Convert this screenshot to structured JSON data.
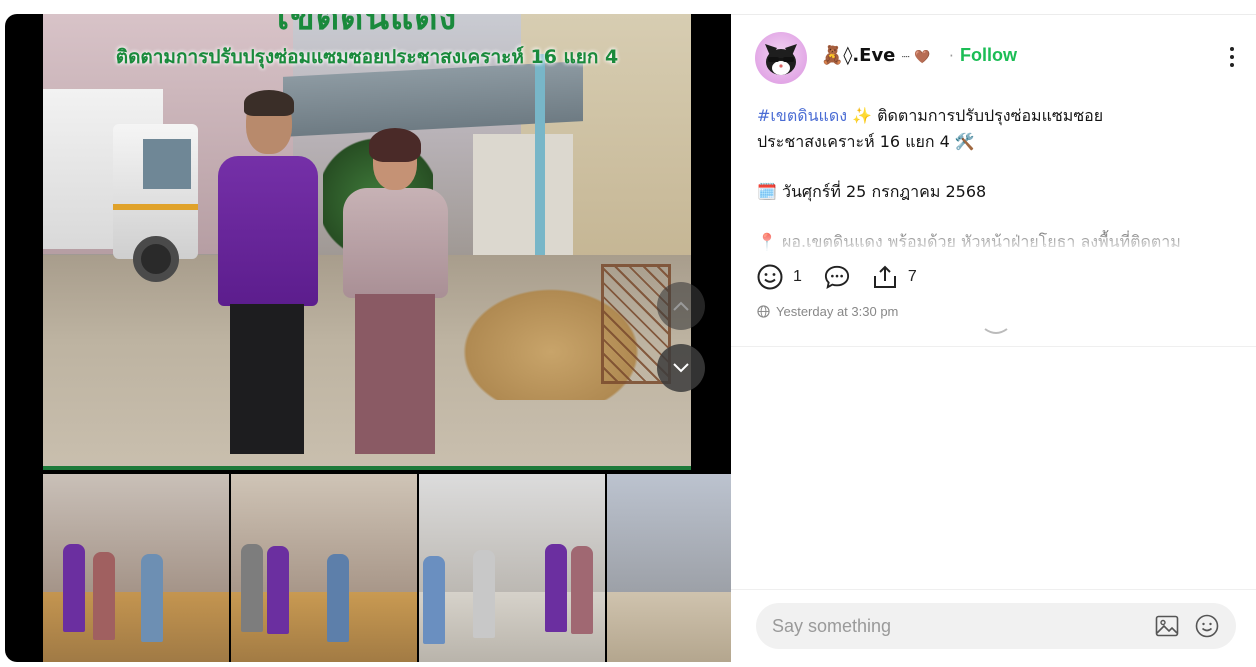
{
  "post_image": {
    "banner_title": "เขตดินแดง",
    "banner_subtitle": "ติดตามการปรับปรุงซ่อมแซมซอยประชาสงเคราะห์ 16 แยก 4"
  },
  "author": {
    "prefix_emoji": "🧸",
    "name": "◊.Eve",
    "suffix": "┈ 🤎",
    "separator": "·",
    "follow_label": "Follow"
  },
  "caption": {
    "hashtag": "#เขตดินแดง",
    "line1_text": " ✨ ติดตามการปรับปรุงซ่อมแซมซอย",
    "line2": "ประชาสงเคราะห์ 16 แยก 4 🛠️",
    "date_line": "🗓️ วันศุกร์ที่ 25 กรกฎาคม 2568",
    "detail_line": "📍 ผอ.เขตดินแดง พร้อมด้วย หัวหน้าฝ่ายโยธา ลงพื้นที่ติดตาม"
  },
  "stats": {
    "reactions": "1",
    "shares": "7"
  },
  "timestamp": "Yesterday at 3:30 pm",
  "composer": {
    "placeholder": "Say something"
  },
  "icons": {
    "nav_up": "chevron-up-icon",
    "nav_down": "chevron-down-icon",
    "thumb_next": "chevron-right-icon",
    "react": "smiley-icon",
    "comment": "comment-bubble-icon",
    "share": "share-upload-icon",
    "globe": "globe-icon",
    "image": "image-icon",
    "emoji": "emoji-icon",
    "more": "kebab-menu-icon"
  },
  "colors": {
    "follow": "#1bbd55",
    "hashtag": "#4a6cd4",
    "banner_green": "#1a8a3c"
  }
}
